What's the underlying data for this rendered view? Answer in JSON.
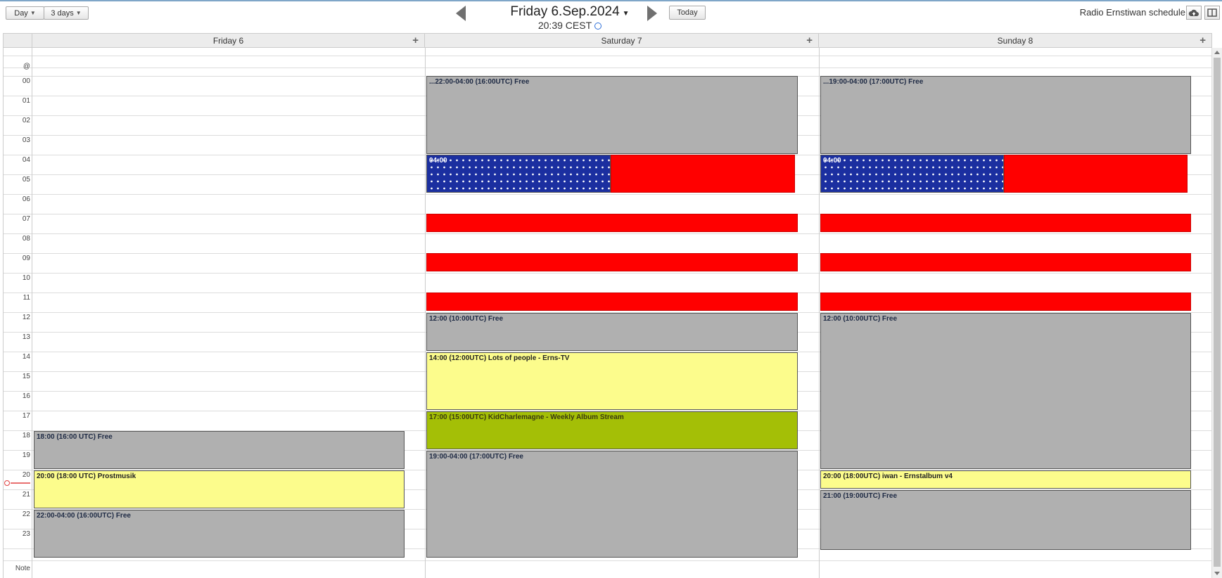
{
  "toolbar": {
    "view_day": "Day",
    "view_3days": "3 days",
    "date_title": "Friday 6.Sep.2024",
    "time_line": "20:39 CEST",
    "today": "Today",
    "schedule_name": "Radio Ernstiwan schedule"
  },
  "days": [
    {
      "label": "Friday 6"
    },
    {
      "label": "Saturday 7"
    },
    {
      "label": "Sunday 8"
    }
  ],
  "rows": {
    "at": "@",
    "hours": [
      "00",
      "01",
      "02",
      "03",
      "04",
      "05",
      "06",
      "07",
      "08",
      "09",
      "10",
      "11",
      "12",
      "13",
      "14",
      "15",
      "16",
      "17",
      "18",
      "19",
      "20",
      "21",
      "22",
      "23"
    ],
    "note": "Note"
  },
  "events": {
    "fri": [
      {
        "label": "18:00 (16:00 UTC) Free"
      },
      {
        "label": "20:00 (18:00 UTC) Prostmusik"
      },
      {
        "label": "22:00-04:00 (16:00UTC) Free"
      }
    ],
    "sat": [
      {
        "label": "...22:00-04:00 (16:00UTC) Free"
      },
      {
        "label": "04:00"
      },
      {
        "label": "12:00 (10:00UTC) Free"
      },
      {
        "label": "14:00 (12:00UTC) Lots of people - Erns-TV"
      },
      {
        "label": "17:00 (15:00UTC) KidCharlemagne - Weekly Album Stream"
      },
      {
        "label": "19:00-04:00 (17:00UTC) Free"
      }
    ],
    "sun": [
      {
        "label": "...19:00-04:00 (17:00UTC) Free"
      },
      {
        "label": "04:00"
      },
      {
        "label": "12:00 (10:00UTC) Free"
      },
      {
        "label": "20:00 (18:00UTC) iwan - Ernstalbum v4"
      },
      {
        "label": "21:00 (19:00UTC) Free"
      }
    ]
  },
  "colors": {
    "free": "#b0b0b0",
    "show": "#fcfc8c",
    "live": "#a4bf06",
    "blocked": "#ff0000",
    "flag_blue": "#1b2fa0",
    "now_marker": "#e04040"
  }
}
